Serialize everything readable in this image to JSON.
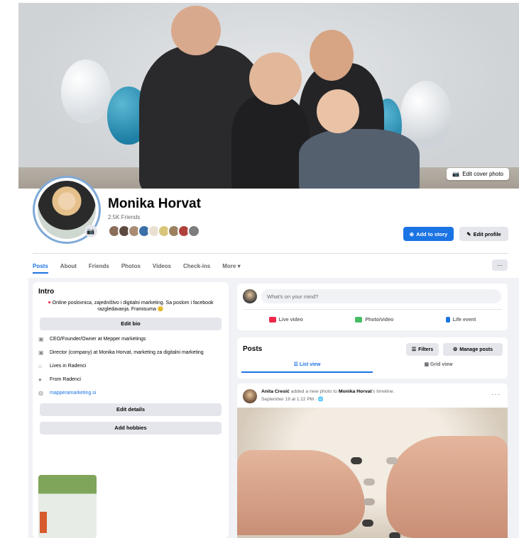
{
  "cover": {
    "edit_label": "Edit cover photo"
  },
  "profile": {
    "name": "Monika Horvat",
    "friends": "2.5K Friends",
    "add_story_label": "Add to story",
    "edit_profile_label": "Edit profile"
  },
  "tabs": [
    {
      "label": "Posts"
    },
    {
      "label": "About"
    },
    {
      "label": "Friends"
    },
    {
      "label": "Photos"
    },
    {
      "label": "Videos"
    },
    {
      "label": "Check-ins"
    },
    {
      "label": "More ▾"
    }
  ],
  "tab_more_button": "···",
  "intro": {
    "title": "Intro",
    "bio": "Online poslovnica, zajedništvo i digitalni marketing. Sa poslom i facebook razgledavanja. Framisuma 😊",
    "edit_bio_label": "Edit bio",
    "details": [
      {
        "icon": "briefcase-icon",
        "text": "CEO/Founder/Owner at Mepper marketings"
      },
      {
        "icon": "briefcase-icon",
        "text": "Director (company) at Monika Horvat, marketing za digitalni marketing"
      },
      {
        "icon": "home-icon",
        "text": "Lives in Radenci"
      },
      {
        "icon": "pin-icon",
        "text": "From Radenci"
      },
      {
        "icon": "globe-icon",
        "text": "mapperamarketing.si",
        "link": true
      }
    ],
    "edit_details_label": "Edit details",
    "add_hobbies_label": "Add hobbies"
  },
  "composer": {
    "placeholder": "What's on your mind?",
    "live_label": "Live video",
    "photo_label": "Photo/video",
    "life_event_label": "Life event"
  },
  "posts": {
    "title": "Posts",
    "filters_label": "Filters",
    "manage_label": "Manage posts",
    "list_view_label": "List view",
    "grid_view_label": "Grid view"
  },
  "post": {
    "author": "Anita Cresić",
    "action": "added a new photo to",
    "target": "Monika Horvat",
    "suffix": "'s timeline.",
    "date": "September 19 at 1:22 PM · 🌐",
    "more": "···"
  },
  "colors": {
    "accent": "#1b74e4",
    "background": "#f0f2f5"
  }
}
